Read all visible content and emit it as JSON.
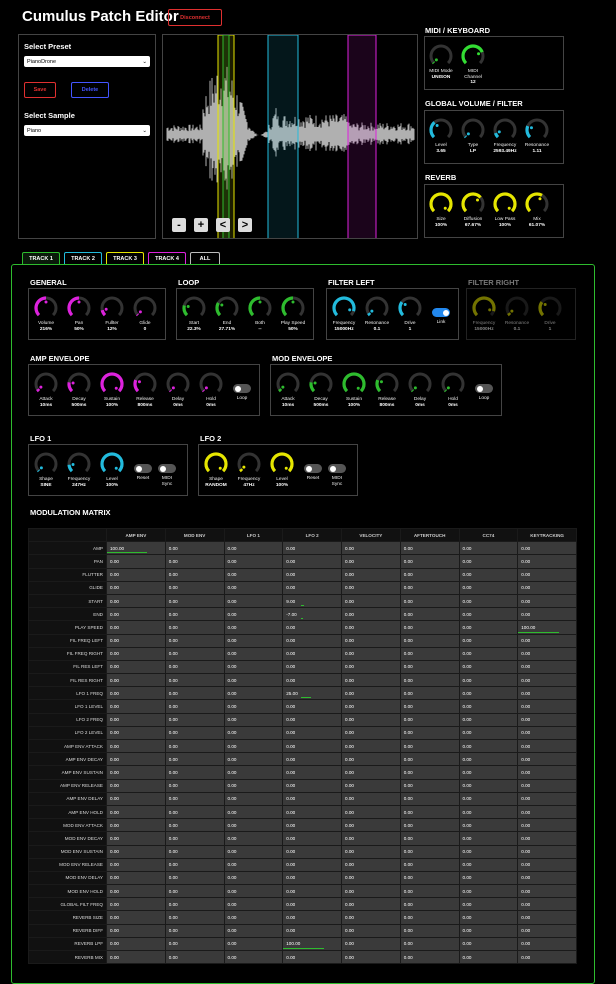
{
  "header": {
    "title": "Cumulus Patch Editor",
    "disconnect": "Disconnect"
  },
  "preset": {
    "heading": "Select Preset",
    "value": "PianoDrone",
    "save": "Save",
    "delete": "Delete",
    "sample_heading": "Select Sample",
    "sample_value": "Piano"
  },
  "waveform": {
    "buttons": [
      "-",
      "+",
      "<",
      ">"
    ]
  },
  "midi": {
    "heading": "MIDI / KEYBOARD",
    "knobs": [
      {
        "label": "MIDI Mode",
        "value": "UNISON",
        "color": "#2ebc2e",
        "level": 0.0
      },
      {
        "label": "MIDI Channel",
        "value": "12",
        "color": "#33dd33",
        "level": 0.75
      }
    ]
  },
  "global": {
    "heading": "GLOBAL VOLUME / FILTER",
    "knobs": [
      {
        "label": "Level",
        "value": "3.65",
        "color": "#22bbdd",
        "level": 0.35
      },
      {
        "label": "Type",
        "value": "LP",
        "color": "#22bbdd",
        "level": 0.0
      },
      {
        "label": "Frequency",
        "value": "2593.49Hz",
        "color": "#22bbdd",
        "level": 0.1
      },
      {
        "label": "Resonance",
        "value": "1.11",
        "color": "#22bbdd",
        "level": 0.25
      }
    ]
  },
  "reverb": {
    "heading": "REVERB",
    "knobs": [
      {
        "label": "Size",
        "value": "100%",
        "color": "#e6e600",
        "level": 1.0
      },
      {
        "label": "Diffusion",
        "value": "67.67%",
        "color": "#e6e600",
        "level": 0.68
      },
      {
        "label": "Low Pass",
        "value": "100%",
        "color": "#e6e600",
        "level": 1.0
      },
      {
        "label": "Mix",
        "value": "61.07%",
        "color": "#e6e600",
        "level": 0.61
      }
    ]
  },
  "tabs": [
    {
      "label": "TRACK 1",
      "color": "#2ebc2e"
    },
    {
      "label": "TRACK 2",
      "color": "#22bbdd"
    },
    {
      "label": "TRACK 3",
      "color": "#e6e600"
    },
    {
      "label": "TRACK 4",
      "color": "#dd22dd"
    },
    {
      "label": "ALL",
      "color": "#bbbbbb"
    }
  ],
  "general": {
    "heading": "GENERAL",
    "knobs": [
      {
        "label": "Volume",
        "value": "216%",
        "color": "#dd22dd",
        "level": 0.5
      },
      {
        "label": "Pan",
        "value": "50%",
        "color": "#dd22dd",
        "level": 0.5
      },
      {
        "label": "Fullter",
        "value": "12%",
        "color": "#dd22dd",
        "level": 0.12
      },
      {
        "label": "Glide",
        "value": "0",
        "color": "#dd22dd",
        "level": 0.0
      }
    ]
  },
  "loop": {
    "heading": "LOOP",
    "knobs": [
      {
        "label": "Start",
        "value": "22.3%",
        "color": "#2ebc2e",
        "level": 0.22
      },
      {
        "label": "End",
        "value": "27.71%",
        "color": "#2ebc2e",
        "level": 0.28
      },
      {
        "label": "Both",
        "value": "--",
        "color": "#2ebc2e",
        "level": 0.5
      },
      {
        "label": "Play Speed",
        "value": "50%",
        "color": "#2ebc2e",
        "level": 0.5
      }
    ]
  },
  "filter_left": {
    "heading": "FILTER LEFT",
    "knobs": [
      {
        "label": "Frequency",
        "value": "15000Hz",
        "color": "#22bbdd",
        "level": 0.9
      },
      {
        "label": "Resonance",
        "value": "0.1",
        "color": "#22bbdd",
        "level": 0.05
      },
      {
        "label": "Drive",
        "value": "1",
        "color": "#22bbdd",
        "level": 0.3
      }
    ],
    "toggle": {
      "label": "Link",
      "on": true
    }
  },
  "filter_right": {
    "heading": "FILTER RIGHT",
    "knobs": [
      {
        "label": "Frequency",
        "value": "15000Hz",
        "color": "#e6e600",
        "level": 0.9
      },
      {
        "label": "Resonance",
        "value": "0.1",
        "color": "#e6e600",
        "level": 0.05
      },
      {
        "label": "Drive",
        "value": "1",
        "color": "#e6e600",
        "level": 0.3
      }
    ]
  },
  "amp_env": {
    "heading": "AMP ENVELOPE",
    "knobs": [
      {
        "label": "Attack",
        "value": "10ms",
        "color": "#dd22dd",
        "level": 0.05
      },
      {
        "label": "Decay",
        "value": "500ms",
        "color": "#dd22dd",
        "level": 0.2
      },
      {
        "label": "Sustain",
        "value": "100%",
        "color": "#dd22dd",
        "level": 1.0
      },
      {
        "label": "Release",
        "value": "800ms",
        "color": "#dd22dd",
        "level": 0.25
      },
      {
        "label": "Delay",
        "value": "0ms",
        "color": "#dd22dd",
        "level": 0.0
      },
      {
        "label": "Hold",
        "value": "0ms",
        "color": "#dd22dd",
        "level": 0.0
      }
    ],
    "toggle": {
      "label": "Loop",
      "on": false
    }
  },
  "mod_env": {
    "heading": "MOD ENVELOPE",
    "knobs": [
      {
        "label": "Attack",
        "value": "10ms",
        "color": "#2ebc2e",
        "level": 0.05
      },
      {
        "label": "Decay",
        "value": "500ms",
        "color": "#2ebc2e",
        "level": 0.2
      },
      {
        "label": "Sustain",
        "value": "100%",
        "color": "#2ebc2e",
        "level": 1.0
      },
      {
        "label": "Release",
        "value": "800ms",
        "color": "#2ebc2e",
        "level": 0.25
      },
      {
        "label": "Delay",
        "value": "0ms",
        "color": "#2ebc2e",
        "level": 0.0
      },
      {
        "label": "Hold",
        "value": "0ms",
        "color": "#2ebc2e",
        "level": 0.0
      }
    ],
    "toggle": {
      "label": "Loop",
      "on": false
    }
  },
  "lfo1": {
    "heading": "LFO 1",
    "knobs": [
      {
        "label": "Shape",
        "value": "SINE",
        "color": "#22bbdd",
        "level": 0.0
      },
      {
        "label": "Frequency",
        "value": "247Hz",
        "color": "#22bbdd",
        "level": 0.15
      },
      {
        "label": "Level",
        "value": "100%",
        "color": "#22bbdd",
        "level": 1.0
      }
    ],
    "toggles": [
      {
        "label": "Reset",
        "on": false
      },
      {
        "label": "MIDI Sync",
        "on": false
      }
    ]
  },
  "lfo2": {
    "heading": "LFO 2",
    "knobs": [
      {
        "label": "Shape",
        "value": "RANDOM",
        "color": "#e6e600",
        "level": 1.0
      },
      {
        "label": "Frequency",
        "value": "47Hz",
        "color": "#e6e600",
        "level": 0.05
      },
      {
        "label": "Level",
        "value": "100%",
        "color": "#e6e600",
        "level": 1.0
      }
    ],
    "toggles": [
      {
        "label": "Reset",
        "on": false
      },
      {
        "label": "MIDI Sync",
        "on": false
      }
    ]
  },
  "matrix": {
    "heading": "MODULATION MATRIX",
    "columns": [
      "AMP ENV",
      "MOD ENV",
      "LFO 1",
      "LFO 2",
      "VELOCITY",
      "AFTERTOUCH",
      "CC74",
      "KEYTRACKING"
    ],
    "rows": [
      {
        "label": "AMP",
        "values": [
          "100.00",
          "0.00",
          "0.00",
          "0.00",
          "0.00",
          "0.00",
          "0.00",
          "0.00"
        ]
      },
      {
        "label": "PAN",
        "values": [
          "0.00",
          "0.00",
          "0.00",
          "0.00",
          "0.00",
          "0.00",
          "0.00",
          "0.00"
        ]
      },
      {
        "label": "FLUTTER",
        "values": [
          "0.00",
          "0.00",
          "0.00",
          "0.00",
          "0.00",
          "0.00",
          "0.00",
          "0.00"
        ]
      },
      {
        "label": "GLIDE",
        "values": [
          "0.00",
          "0.00",
          "0.00",
          "0.00",
          "0.00",
          "0.00",
          "0.00",
          "0.00"
        ]
      },
      {
        "label": "START",
        "values": [
          "0.00",
          "0.00",
          "0.00",
          "9.00",
          "0.00",
          "0.00",
          "0.00",
          "0.00"
        ]
      },
      {
        "label": "END",
        "values": [
          "0.00",
          "0.00",
          "0.00",
          "-7.00",
          "0.00",
          "0.00",
          "0.00",
          "0.00"
        ]
      },
      {
        "label": "PLAY SPEED",
        "values": [
          "0.00",
          "0.00",
          "0.00",
          "0.00",
          "0.00",
          "0.00",
          "0.00",
          "100.00"
        ]
      },
      {
        "label": "FIL FREQ LEFT",
        "values": [
          "0.00",
          "0.00",
          "0.00",
          "0.00",
          "0.00",
          "0.00",
          "0.00",
          "0.00"
        ]
      },
      {
        "label": "FIL FREQ RIGHT",
        "values": [
          "0.00",
          "0.00",
          "0.00",
          "0.00",
          "0.00",
          "0.00",
          "0.00",
          "0.00"
        ]
      },
      {
        "label": "FIL RES LEFT",
        "values": [
          "0.00",
          "0.00",
          "0.00",
          "0.00",
          "0.00",
          "0.00",
          "0.00",
          "0.00"
        ]
      },
      {
        "label": "FIL RES RIGHT",
        "values": [
          "0.00",
          "0.00",
          "0.00",
          "0.00",
          "0.00",
          "0.00",
          "0.00",
          "0.00"
        ]
      },
      {
        "label": "LFO 1 FREQ",
        "values": [
          "0.00",
          "0.00",
          "0.00",
          "25.00",
          "0.00",
          "0.00",
          "0.00",
          "0.00"
        ]
      },
      {
        "label": "LFO 1 LEVEL",
        "values": [
          "0.00",
          "0.00",
          "0.00",
          "0.00",
          "0.00",
          "0.00",
          "0.00",
          "0.00"
        ]
      },
      {
        "label": "LFO 2 FREQ",
        "values": [
          "0.00",
          "0.00",
          "0.00",
          "0.00",
          "0.00",
          "0.00",
          "0.00",
          "0.00"
        ]
      },
      {
        "label": "LFO 2 LEVEL",
        "values": [
          "0.00",
          "0.00",
          "0.00",
          "0.00",
          "0.00",
          "0.00",
          "0.00",
          "0.00"
        ]
      },
      {
        "label": "AMP ENV ATTACK",
        "values": [
          "0.00",
          "0.00",
          "0.00",
          "0.00",
          "0.00",
          "0.00",
          "0.00",
          "0.00"
        ]
      },
      {
        "label": "AMP ENV DECAY",
        "values": [
          "0.00",
          "0.00",
          "0.00",
          "0.00",
          "0.00",
          "0.00",
          "0.00",
          "0.00"
        ]
      },
      {
        "label": "AMP ENV SUSTAIN",
        "values": [
          "0.00",
          "0.00",
          "0.00",
          "0.00",
          "0.00",
          "0.00",
          "0.00",
          "0.00"
        ]
      },
      {
        "label": "AMP ENV RELEASE",
        "values": [
          "0.00",
          "0.00",
          "0.00",
          "0.00",
          "0.00",
          "0.00",
          "0.00",
          "0.00"
        ]
      },
      {
        "label": "AMP ENV DELAY",
        "values": [
          "0.00",
          "0.00",
          "0.00",
          "0.00",
          "0.00",
          "0.00",
          "0.00",
          "0.00"
        ]
      },
      {
        "label": "AMP ENV HOLD",
        "values": [
          "0.00",
          "0.00",
          "0.00",
          "0.00",
          "0.00",
          "0.00",
          "0.00",
          "0.00"
        ]
      },
      {
        "label": "MOD ENV ATTACK",
        "values": [
          "0.00",
          "0.00",
          "0.00",
          "0.00",
          "0.00",
          "0.00",
          "0.00",
          "0.00"
        ]
      },
      {
        "label": "MOD ENV DECAY",
        "values": [
          "0.00",
          "0.00",
          "0.00",
          "0.00",
          "0.00",
          "0.00",
          "0.00",
          "0.00"
        ]
      },
      {
        "label": "MOD ENV SUSTAIN",
        "values": [
          "0.00",
          "0.00",
          "0.00",
          "0.00",
          "0.00",
          "0.00",
          "0.00",
          "0.00"
        ]
      },
      {
        "label": "MOD ENV RELEASE",
        "values": [
          "0.00",
          "0.00",
          "0.00",
          "0.00",
          "0.00",
          "0.00",
          "0.00",
          "0.00"
        ]
      },
      {
        "label": "MOD ENV DELAY",
        "values": [
          "0.00",
          "0.00",
          "0.00",
          "0.00",
          "0.00",
          "0.00",
          "0.00",
          "0.00"
        ]
      },
      {
        "label": "MOD ENV HOLD",
        "values": [
          "0.00",
          "0.00",
          "0.00",
          "0.00",
          "0.00",
          "0.00",
          "0.00",
          "0.00"
        ]
      },
      {
        "label": "GLOBAL FILT FREQ",
        "values": [
          "0.00",
          "0.00",
          "0.00",
          "0.00",
          "0.00",
          "0.00",
          "0.00",
          "0.00"
        ]
      },
      {
        "label": "REVERB SIZE",
        "values": [
          "0.00",
          "0.00",
          "0.00",
          "0.00",
          "0.00",
          "0.00",
          "0.00",
          "0.00"
        ]
      },
      {
        "label": "REVERB DIFF",
        "values": [
          "0.00",
          "0.00",
          "0.00",
          "0.00",
          "0.00",
          "0.00",
          "0.00",
          "0.00"
        ]
      },
      {
        "label": "REVERB LPF",
        "values": [
          "0.00",
          "0.00",
          "0.00",
          "100.00",
          "0.00",
          "0.00",
          "0.00",
          "0.00"
        ]
      },
      {
        "label": "REVERB MIX",
        "values": [
          "0.00",
          "0.00",
          "0.00",
          "0.00",
          "0.00",
          "0.00",
          "0.00",
          "0.00"
        ]
      }
    ]
  }
}
